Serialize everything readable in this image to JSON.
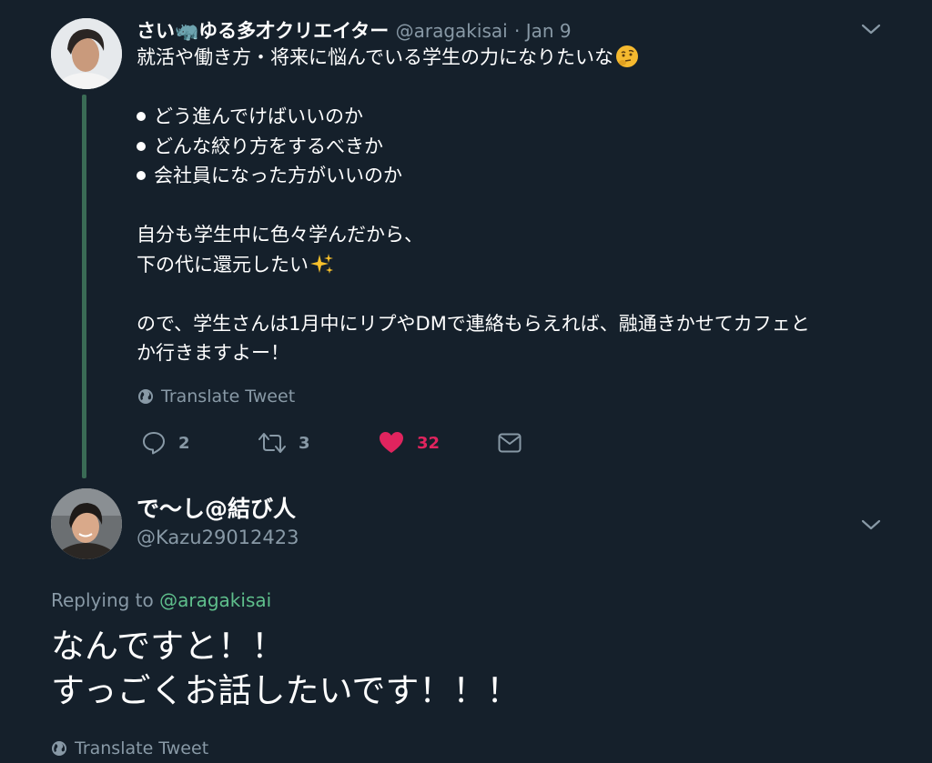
{
  "tweet": {
    "author_name": "さい🦏ゆる多才クリエイター",
    "handle": "@aragakisai",
    "date": "· Jan 9",
    "lines": [
      "就活や働き方・将来に悩んでいる学生の力になりたいな",
      "",
      "どう進んでけばいいのか",
      "どんな絞り方をするべきか",
      "会社員になった方がいいのか",
      "",
      "自分も学生中に色々学んだから、",
      "下の代に還元したい",
      "",
      "ので、学生さんは1月中にリプやDMで連絡もらえれば、融通きかせてカフェと",
      "か行きますよー！"
    ],
    "translate_label": "Translate Tweet",
    "actions": {
      "reply_count": "2",
      "retweet_count": "3",
      "like_count": "32"
    },
    "colors": {
      "like": "#e0245e",
      "thread_line": "#3a6b55"
    }
  },
  "reply": {
    "author_name": "で〜し@結び人",
    "handle": "@Kazu29012423",
    "replying_prefix": "Replying to",
    "replying_to": "@aragakisai",
    "lines": [
      "なんですと！！",
      "すっごくお話したいです！！！"
    ],
    "translate_label": "Translate Tweet"
  }
}
